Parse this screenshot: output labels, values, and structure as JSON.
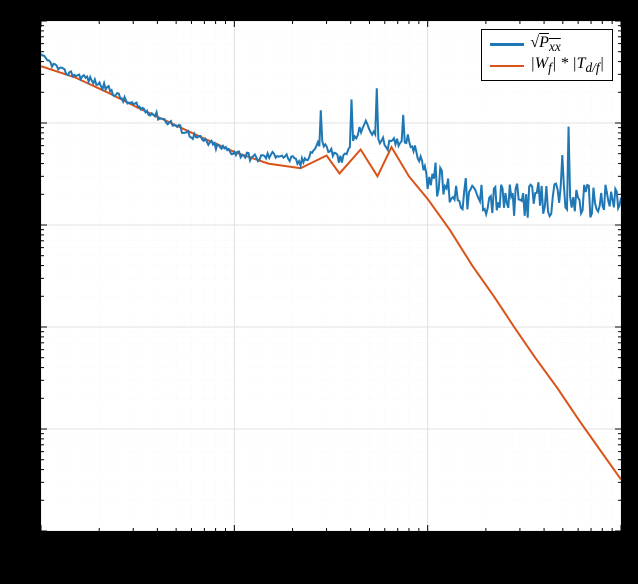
{
  "chart_data": {
    "type": "line",
    "x_scale": "log",
    "y_scale": "log",
    "xlim": [
      1,
      1000
    ],
    "ylim": [
      0.001,
      100
    ],
    "title": "",
    "xlabel": "",
    "ylabel": "",
    "legend_position": "top-right",
    "series": [
      {
        "name": "sqrt(Pxx)",
        "label_tex": "\\sqrt{P_{xx}}",
        "color": "#1f77b4",
        "x": [
          1,
          1.3,
          1.7,
          2.2,
          2.8,
          3.6,
          4.7,
          6.1,
          7.9,
          10,
          13,
          17,
          22,
          28,
          36,
          47,
          61,
          79,
          100,
          130,
          170,
          220,
          280,
          360,
          470,
          610,
          790,
          1000
        ],
        "y": [
          45,
          32,
          28,
          22,
          16,
          13,
          10,
          7.5,
          6.0,
          5.2,
          4.5,
          5.0,
          4.0,
          6.5,
          4.2,
          10,
          6.0,
          7.2,
          3.2,
          2.2,
          1.9,
          1.8,
          1.7,
          1.8,
          1.7,
          1.8,
          1.7,
          1.8
        ],
        "noise_band": {
          "start_x": 100,
          "amplitude_rel": 0.35
        },
        "spikes": [
          {
            "x": 28,
            "y": 14
          },
          {
            "x": 40,
            "y": 18
          },
          {
            "x": 55,
            "y": 20
          },
          {
            "x": 75,
            "y": 12
          },
          {
            "x": 500,
            "y": 6
          },
          {
            "x": 540,
            "y": 7
          }
        ]
      },
      {
        "name": "|Wf|*|Td/f|",
        "label_tex": "|W_f|*|T_{d/f}|",
        "color": "#d95319",
        "x": [
          1,
          1.5,
          2.2,
          3.2,
          4.7,
          6.8,
          10,
          15,
          22,
          30,
          35,
          45,
          55,
          65,
          80,
          100,
          130,
          170,
          220,
          280,
          360,
          470,
          610,
          790,
          1000
        ],
        "y": [
          36,
          28,
          20,
          14,
          10,
          7.2,
          5.2,
          4.0,
          3.6,
          4.8,
          3.2,
          5.5,
          3.0,
          5.8,
          3.0,
          1.8,
          0.9,
          0.4,
          0.2,
          0.1,
          0.05,
          0.025,
          0.012,
          0.006,
          0.0032
        ]
      }
    ],
    "grid": {
      "major": true,
      "minor": true
    }
  },
  "legend": {
    "items": [
      {
        "color": "#1f77b4",
        "label_html": "√<span style='text-decoration:overline;'>P<sub>xx</sub></span>"
      },
      {
        "color": "#d95319",
        "label_html": "|W<sub>f</sub>| * |T<sub>d/f</sub>|"
      }
    ]
  }
}
